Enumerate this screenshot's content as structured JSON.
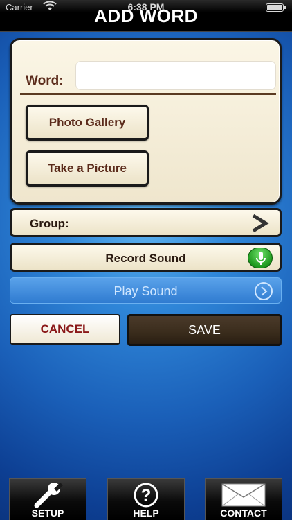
{
  "status": {
    "carrier": "Carrier",
    "time": "6:38 PM"
  },
  "header": {
    "title": "ADD WORD"
  },
  "form": {
    "word_label": "Word:",
    "word_value": "",
    "photo_gallery_label": "Photo Gallery",
    "take_picture_label": "Take a Picture",
    "group_label": "Group:",
    "record_sound_label": "Record Sound",
    "play_sound_label": "Play Sound"
  },
  "actions": {
    "cancel_label": "CANCEL",
    "save_label": "SAVE"
  },
  "tabbar": {
    "items": [
      {
        "label": "SETUP",
        "icon": "wrench-icon"
      },
      {
        "label": "HELP",
        "icon": "question-icon"
      },
      {
        "label": "CONTACT",
        "icon": "envelope-icon"
      }
    ]
  },
  "colors": {
    "accent_text": "#5a2a1a",
    "cancel_text": "#8a1818",
    "mic_green": "#1f9a1f"
  }
}
